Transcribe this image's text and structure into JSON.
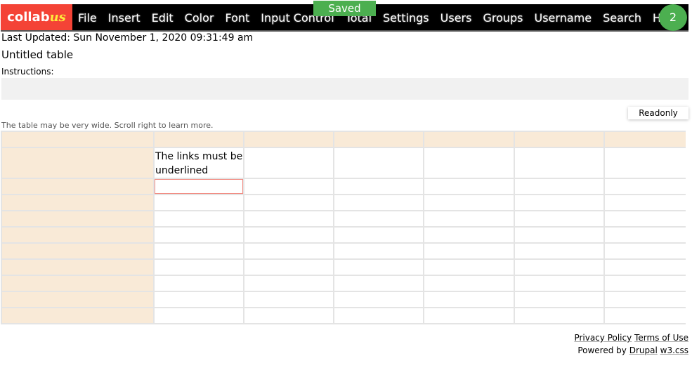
{
  "nav": {
    "logo_main": "collab",
    "logo_accent": "us",
    "menu": [
      "File",
      "Insert",
      "Edit",
      "Color",
      "Font",
      "Input Control",
      "Total",
      "Settings",
      "Users",
      "Groups",
      "Username",
      "Search",
      "Help"
    ],
    "saved": "Saved",
    "user_count": "2"
  },
  "last_updated": "Last Updated: Sun November 1, 2020 09:31:49 am",
  "title": "Untitled table",
  "instructions_label": "Instructions:",
  "readonly_button": "Readonly",
  "wide_note": "The table may be very wide. Scroll right to learn more.",
  "table": {
    "cell_r1_c1": "The links must be underlined"
  },
  "footer": {
    "privacy": "Privacy Policy",
    "terms": "Terms of Use",
    "powered": "Powered by",
    "drupal": "Drupal",
    "w3css": "w3.css"
  }
}
